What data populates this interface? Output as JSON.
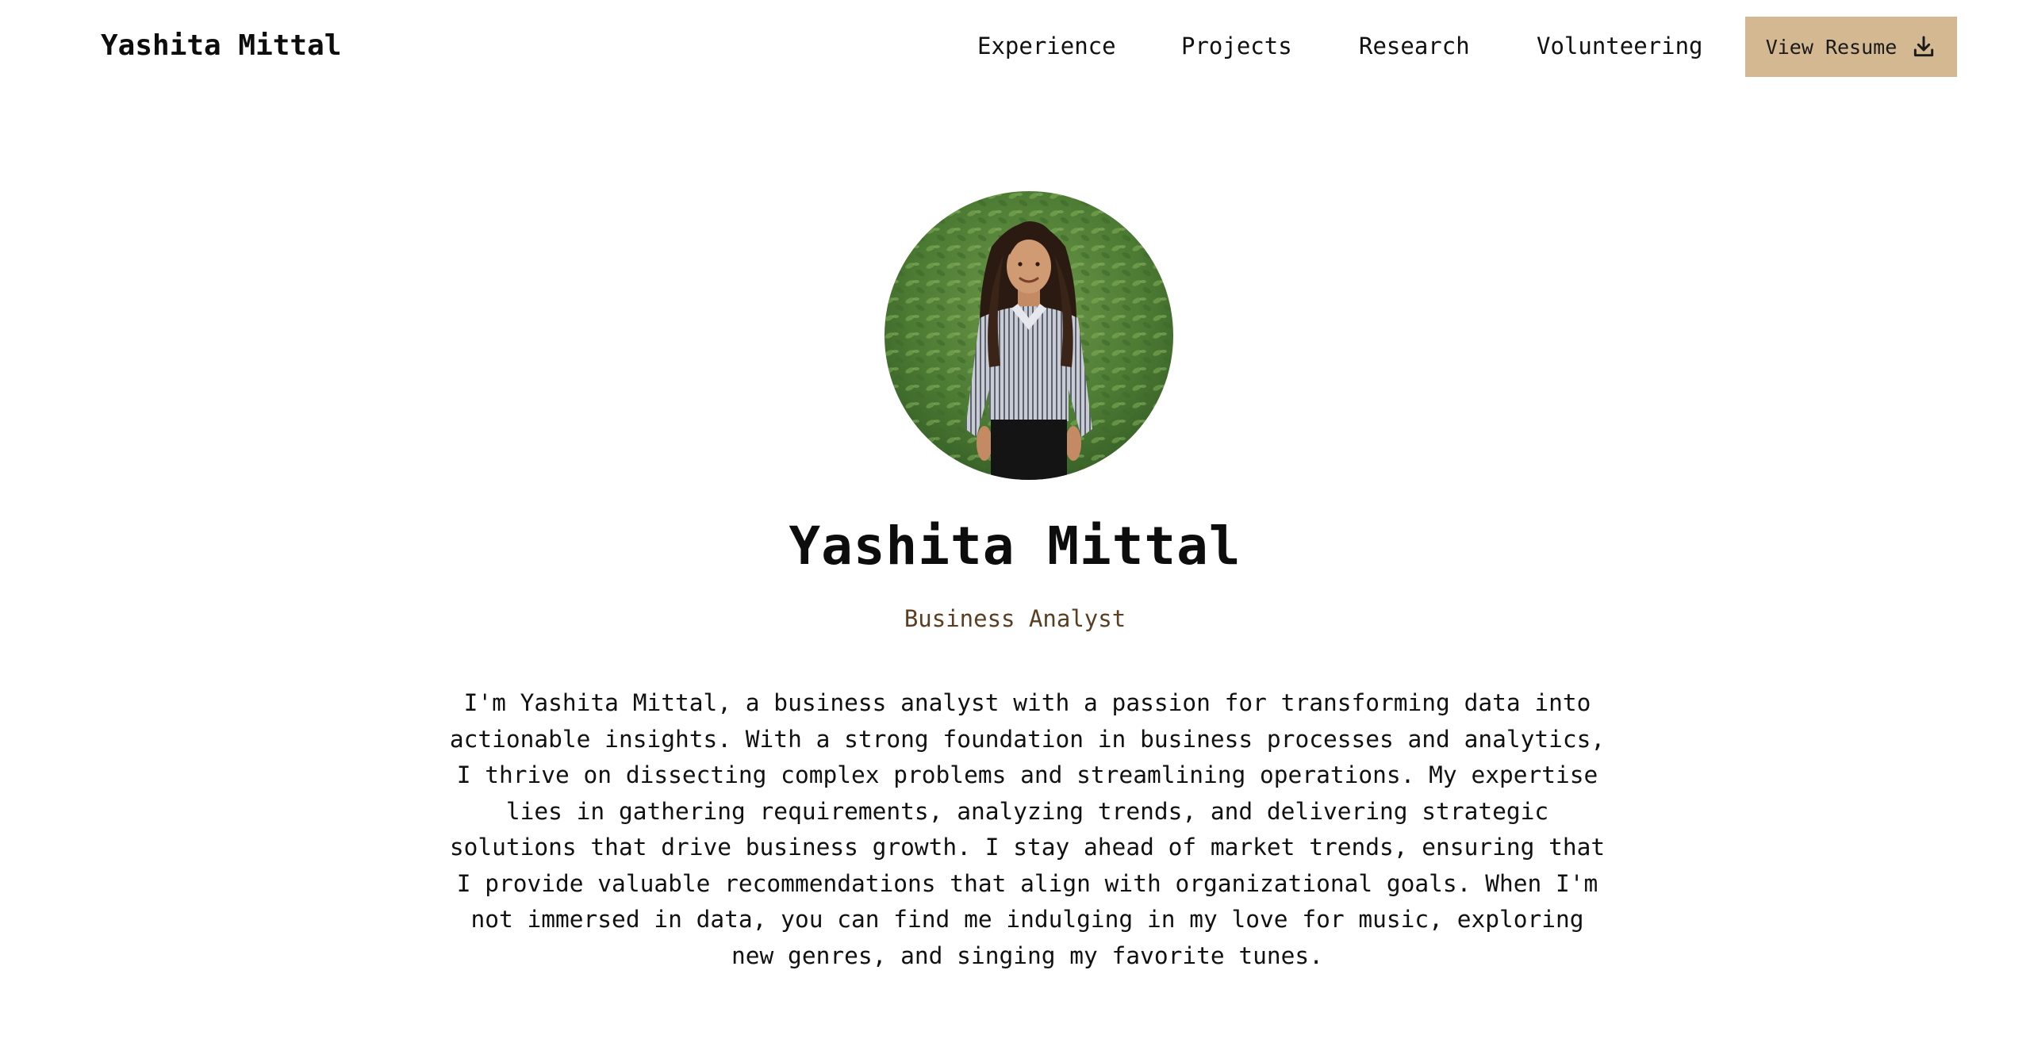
{
  "header": {
    "brand": "Yashita Mittal",
    "nav": {
      "experience": "Experience",
      "projects": "Projects",
      "research": "Research",
      "volunteering": "Volunteering"
    },
    "resume_button": {
      "label": "View Resume",
      "icon": "download-icon"
    }
  },
  "hero": {
    "avatar_icon": "profile-photo",
    "name": "Yashita Mittal",
    "title": "Business Analyst",
    "bio": "I'm Yashita Mittal, a business analyst with a passion for transforming data into actionable insights. With a strong foundation in business processes and analytics, I thrive on dissecting complex problems and streamlining operations. My expertise lies in gathering requirements, analyzing trends, and delivering strategic solutions that drive business growth. I stay ahead of market trends, ensuring that I provide valuable recommendations that align with organizational goals. When I'm not immersed in data, you can find me indulging in my love for music, exploring new genres, and singing my favorite tunes."
  },
  "colors": {
    "accent": "#d3b892",
    "subtitle": "#5a3e22",
    "text": "#111111",
    "background": "#ffffff"
  }
}
